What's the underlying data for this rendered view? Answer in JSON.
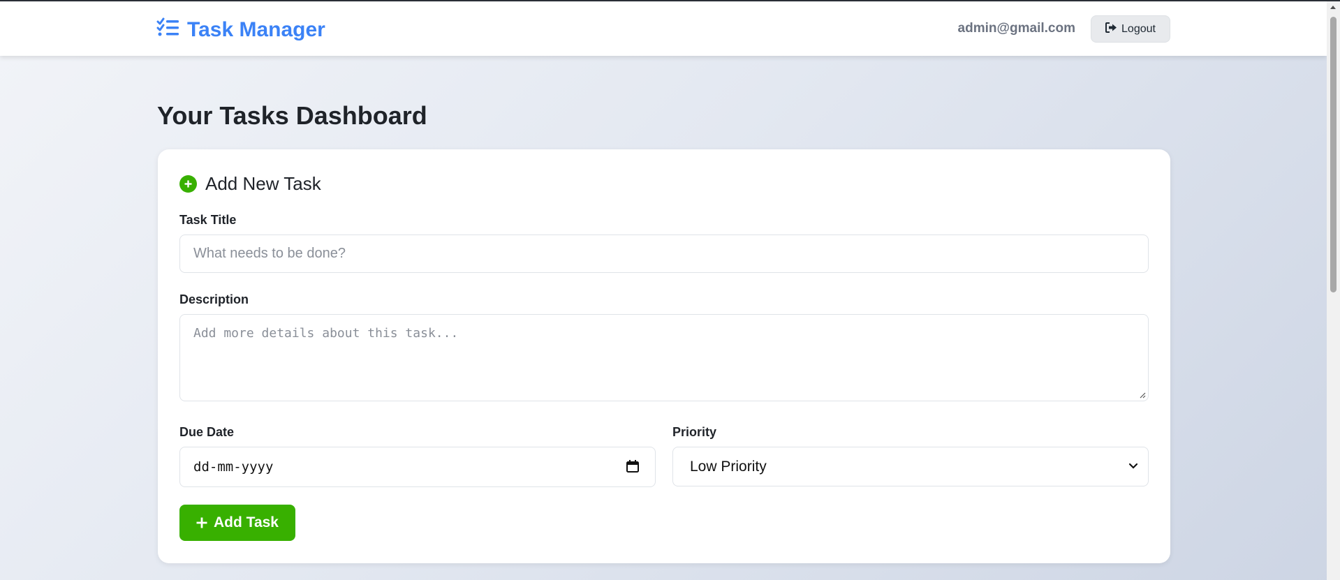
{
  "app": {
    "title": "Task Manager",
    "user_email": "admin@gmail.com",
    "logout_label": "Logout",
    "accent_color": "#3b82f6"
  },
  "page": {
    "title": "Your Tasks Dashboard"
  },
  "form": {
    "header": "Add New Task",
    "title_label": "Task Title",
    "title_placeholder": "What needs to be done?",
    "description_label": "Description",
    "description_placeholder": "Add more details about this task...",
    "due_date_label": "Due Date",
    "due_date_value": "dd-mm-yyyy",
    "priority_label": "Priority",
    "priority_selected": "Low Priority",
    "submit_label": "Add Task",
    "submit_color": "#38b000"
  },
  "icons": {
    "brand": "tasks-list-icon",
    "logout": "sign-out-icon",
    "add_header": "plus-circle-icon",
    "calendar": "calendar-icon",
    "select": "chevron-down-icon",
    "submit": "plus-icon"
  }
}
